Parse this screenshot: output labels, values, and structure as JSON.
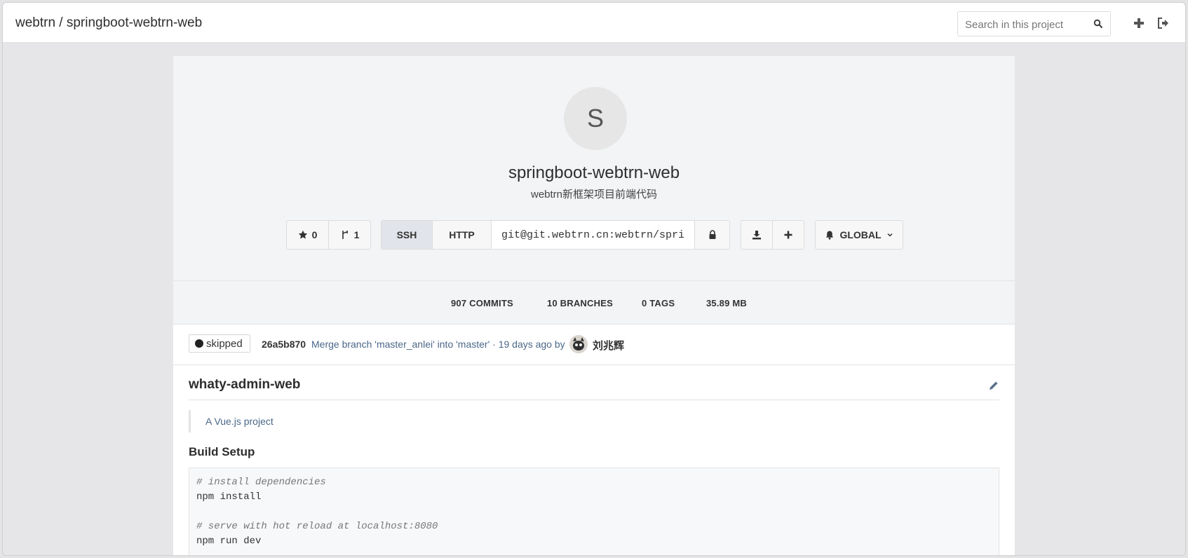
{
  "header": {
    "breadcrumb": "webtrn / springboot-webtrn-web",
    "search_placeholder": "Search in this project"
  },
  "project": {
    "avatar_letter": "S",
    "name": "springboot-webtrn-web",
    "description": "webtrn新框架项目前端代码",
    "stars": "0",
    "forks": "1",
    "clone_tabs": [
      "SSH",
      "HTTP"
    ],
    "active_clone_tab": "SSH",
    "clone_url": "git@git.webtrn.cn:webtrn/springboot-webtrn-web.git",
    "notification_level": "GLOBAL"
  },
  "stats": {
    "commits": "907 COMMITS",
    "branches": "10 BRANCHES",
    "tags": "0 TAGS",
    "size": "35.89 MB"
  },
  "last_commit": {
    "ci_status": "skipped",
    "sha": "26a5b870",
    "message": "Merge branch 'master_anlei' into 'master' · 19 days ago by",
    "author": "刘兆辉"
  },
  "readme": {
    "title": "whaty-admin-web",
    "quote": "A Vue.js project",
    "section_title": "Build Setup",
    "code_lines": [
      {
        "text": "# install dependencies",
        "comment": true
      },
      {
        "text": "npm install",
        "comment": false
      },
      {
        "text": "",
        "comment": false
      },
      {
        "text": "# serve with hot reload at localhost:8080",
        "comment": true
      },
      {
        "text": "npm run dev",
        "comment": false
      }
    ]
  },
  "icons": {
    "search": "search-icon",
    "new": "plus-icon",
    "signout": "sign-out-icon",
    "star": "star-icon",
    "fork": "fork-icon",
    "lock": "lock-icon",
    "download": "download-icon",
    "bell": "bell-icon",
    "chevron": "chevron-down-icon",
    "edit": "pencil-icon"
  }
}
